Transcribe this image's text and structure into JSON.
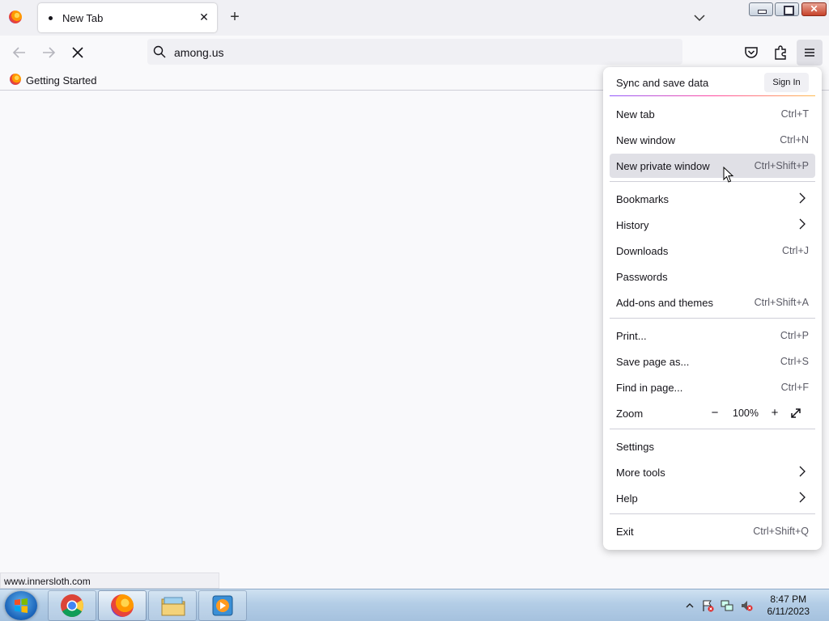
{
  "browser": {
    "tab": {
      "title": "New Tab",
      "close": "✕"
    },
    "new_tab": "+",
    "url": "among.us",
    "bookmarks": [
      {
        "label": "Getting Started"
      }
    ],
    "status_url": "www.innersloth.com"
  },
  "app_menu": {
    "sync": {
      "label": "Sync and save data",
      "button": "Sign In"
    },
    "items": [
      {
        "label": "New tab",
        "shortcut": "Ctrl+T"
      },
      {
        "label": "New window",
        "shortcut": "Ctrl+N"
      },
      {
        "label": "New private window",
        "shortcut": "Ctrl+Shift+P"
      },
      {
        "label": "Bookmarks",
        "shortcut": ""
      },
      {
        "label": "History",
        "shortcut": ""
      },
      {
        "label": "Downloads",
        "shortcut": "Ctrl+J"
      },
      {
        "label": "Passwords",
        "shortcut": ""
      },
      {
        "label": "Add-ons and themes",
        "shortcut": "Ctrl+Shift+A"
      },
      {
        "label": "Print...",
        "shortcut": "Ctrl+P"
      },
      {
        "label": "Save page as...",
        "shortcut": "Ctrl+S"
      },
      {
        "label": "Find in page...",
        "shortcut": "Ctrl+F"
      },
      {
        "label": "Zoom",
        "shortcut": ""
      },
      {
        "label": "Settings",
        "shortcut": ""
      },
      {
        "label": "More tools",
        "shortcut": ""
      },
      {
        "label": "Help",
        "shortcut": ""
      },
      {
        "label": "Exit",
        "shortcut": "Ctrl+Shift+Q"
      }
    ],
    "zoom": {
      "minus": "−",
      "value": "100%",
      "plus": "+"
    }
  },
  "taskbar": {
    "time": "8:47 PM",
    "date": "6/11/2023"
  },
  "colors": {
    "accent_gradient": [
      "#9059ff",
      "#ff4aa2",
      "#ffbd4f"
    ],
    "menu_hover": "#e0e0e6"
  }
}
